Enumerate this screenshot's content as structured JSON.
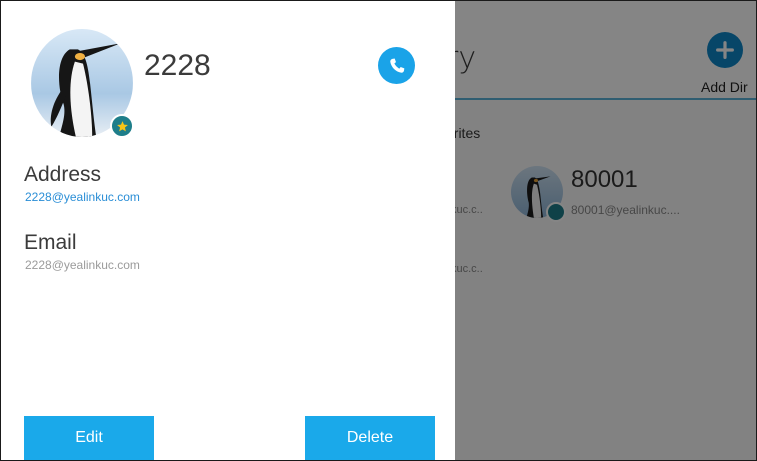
{
  "background": {
    "title": "ry",
    "add_button_label": "Add Dir",
    "section_label": "orites",
    "partial_subtitle_1": "kuc.c..",
    "partial_subtitle_2": "kuc.c..",
    "favorite_contact": {
      "name": "80001",
      "address": "80001@yealinkuc...."
    }
  },
  "contact_detail": {
    "name": "2228",
    "address_label": "Address",
    "address_value": "2228@yealinkuc.com",
    "email_label": "Email",
    "email_value": "2228@yealinkuc.com",
    "edit_label": "Edit",
    "delete_label": "Delete"
  },
  "colors": {
    "accent": "#1aa9ea",
    "link": "#2a8ed6",
    "badge": "#1e7e8a"
  },
  "icons": [
    "phone-icon",
    "plus-icon",
    "star-badge-icon",
    "penguin-avatar"
  ]
}
